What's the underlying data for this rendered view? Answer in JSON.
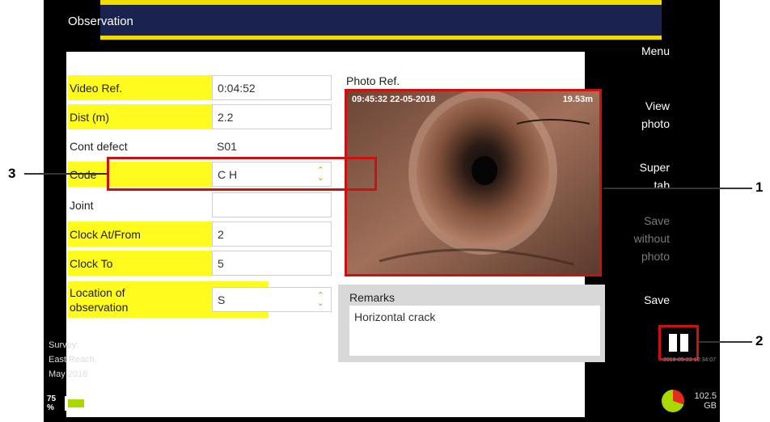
{
  "header": {
    "title": "Observation"
  },
  "fields": [
    {
      "label": "Video Ref.",
      "value": "0:04:52",
      "highlight": true,
      "spinner": false,
      "plain": false
    },
    {
      "label": "Dist (m)",
      "value": "2.2",
      "highlight": true,
      "spinner": false,
      "plain": false
    },
    {
      "label": "Cont defect",
      "value": "S01",
      "highlight": false,
      "spinner": false,
      "plain": true
    },
    {
      "label": "Code",
      "value": "C H",
      "highlight": true,
      "spinner": true,
      "plain": false
    },
    {
      "label": "Joint",
      "value": "",
      "highlight": false,
      "spinner": false,
      "plain": false
    },
    {
      "label": "Clock At/From",
      "value": "2",
      "highlight": true,
      "spinner": false,
      "plain": false
    },
    {
      "label": "Clock To",
      "value": "5",
      "highlight": true,
      "spinner": false,
      "plain": false
    },
    {
      "label": "Location of observation",
      "value": "S",
      "highlight": true,
      "spinner": true,
      "plain": false
    }
  ],
  "photo": {
    "label": "Photo Ref.",
    "timestamp": "09:45:32 22-05-2018",
    "distance": "19.53m"
  },
  "remarks": {
    "label": "Remarks",
    "text": "Horizontal crack"
  },
  "menu": {
    "menu": "Menu",
    "view_photo_1": "View",
    "view_photo_2": "photo",
    "super_tab_1": "Super",
    "super_tab_2": "tab",
    "save_without_1": "Save",
    "save_without_2": "without",
    "save_without_3": "photo",
    "save": "Save"
  },
  "left_info": {
    "survey_label": "Survey:",
    "survey_name_1": "East Reach,",
    "survey_name_2": "May 2018"
  },
  "battery": {
    "percent": "75",
    "unit": "%",
    "level": 0.75
  },
  "storage": {
    "amount": "102.5",
    "unit": "GB",
    "used_fraction": 0.3
  },
  "recording": {
    "time": "2018-05-22 10:34:07"
  },
  "callouts": [
    "1",
    "2",
    "3"
  ],
  "colors": {
    "header_bg": "#1a2350",
    "accent_yellow": "#f2dc00",
    "field_yellow": "#fffb1f",
    "callout_red": "#cc1111"
  }
}
